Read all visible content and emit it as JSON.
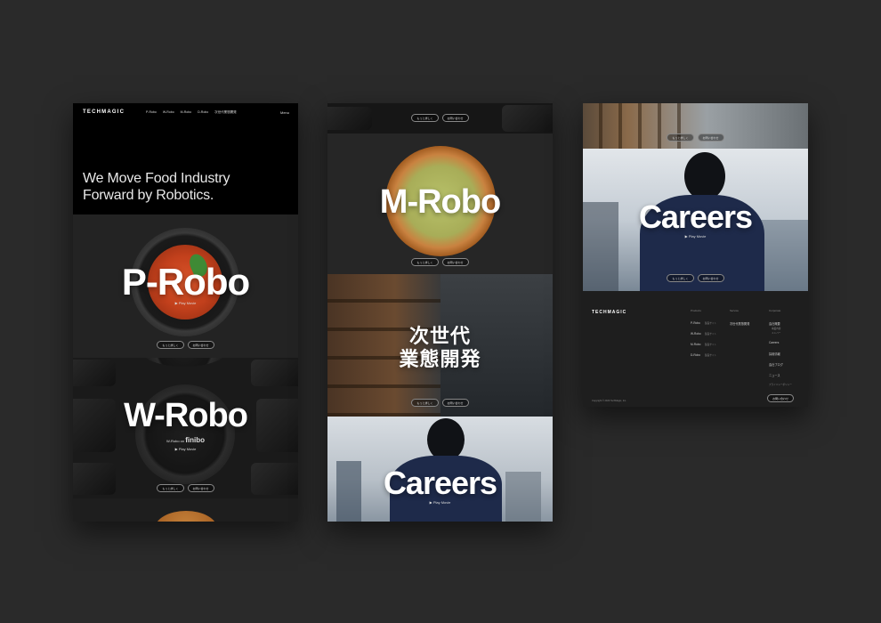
{
  "brand": "TECHMAGIC",
  "nav": {
    "items": [
      "P-Robo",
      "W-Robo",
      "M-Robo",
      "D-Robo",
      "次世代業態開発"
    ],
    "menu": "Menu"
  },
  "hero": {
    "line1": "We Move Food Industry",
    "line2": "Forward by Robotics."
  },
  "sections": {
    "probo": {
      "title": "P-Robo",
      "sub": "Play Movie",
      "btn1": "もっと詳しく",
      "btn2": "お問い合わせ"
    },
    "wrobo": {
      "title": "W-Robo",
      "sub_prefix": "W-Robo on",
      "brand": "finibo",
      "sub": "Play Movie",
      "btn1": "もっと詳しく",
      "btn2": "お問い合わせ"
    },
    "mrobo": {
      "title": "M-Robo",
      "btn1": "もっと詳しく",
      "btn2": "お問い合わせ"
    },
    "next": {
      "line1": "次世代",
      "line2": "業態開発",
      "btn1": "もっと詳しく",
      "btn2": "お問い合わせ"
    },
    "careers": {
      "title": "Careers",
      "sub": "Play Movie",
      "btn1": "もっと詳しく",
      "btn2": "お問い合わせ"
    }
  },
  "top_pills": {
    "btn1": "もっと詳しく",
    "btn2": "お問い合わせ"
  },
  "footer": {
    "logo": "TECHMAGIC",
    "col_product": "Products",
    "col_service": "Service",
    "col_corporate": "Corporate",
    "products": [
      "P-Robo",
      "W-Robo",
      "M-Robo",
      "D-Robo"
    ],
    "product_link": "製品サイト",
    "service": "次世代業態開発",
    "corporate": [
      "会社概要",
      "Careers",
      "採用情報",
      "会社ブログ",
      "ニュース",
      "プライバシーポリシー"
    ],
    "corporate_sub": [
      "事業内容",
      "メンバー"
    ],
    "contact": "お問い合わせ",
    "copyright": "Copyright © 2023 TechMagic, Inc."
  }
}
